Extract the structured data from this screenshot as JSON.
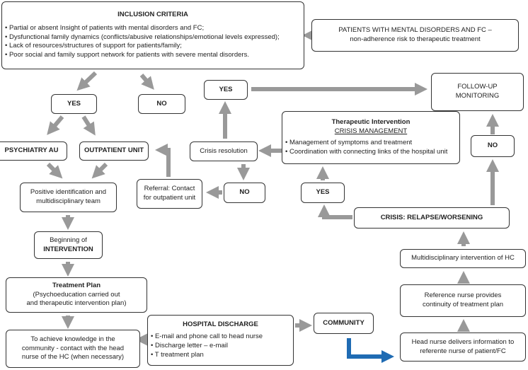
{
  "inclusion": {
    "title": "INCLUSION CRITERIA",
    "items": [
      "Partial or absent Insight of patients with mental disorders and FC;",
      "Dysfunctional family dynamics (conflicts/abusive relationships/emotional levels expressed);",
      "Lack of resources/structures of support for patients/family;",
      "Poor social and family support network for patients with severe mental disorders."
    ]
  },
  "patients": {
    "line1": "PATIENTS WITH MENTAL DISORDERS AND FC –",
    "line2": "non-adherence risk to therapeutic treatment"
  },
  "yes1": "YES",
  "no1": "NO",
  "yes2": "YES",
  "no2": "NO",
  "yes3": "YES",
  "no3": "NO",
  "psychiatry": "PSYCHIATRY AU",
  "outpatient": "OUTPATIENT UNIT",
  "positive": {
    "line1": "Positive identification and",
    "line2": "multidisciplinary team"
  },
  "beginning": {
    "line1": "Beginning of",
    "line2": "INTERVENTION"
  },
  "treatment": {
    "title": "Treatment Plan",
    "line1": "(Psychoeducation carried out",
    "line2": "and therapeutic intervention plan)"
  },
  "achieve": {
    "line1": "To achieve knowledge in the",
    "line2": "community - contact with the head",
    "line3": "nurse of the HC (when necessary)"
  },
  "discharge": {
    "title": "HOSPITAL DISCHARGE",
    "items": [
      "E-mail and phone call to head nurse",
      "Discharge letter – e-mail",
      "T treatment plan"
    ]
  },
  "community": "COMMUNITY",
  "headnurse": {
    "line1": "Head nurse delivers information to",
    "line2": "referente nurse of patient/FC"
  },
  "refnurse": {
    "line1": "Reference nurse provides",
    "line2": "continuity of treatment plan"
  },
  "multi_hc": "Multidisciplinary intervention of HC",
  "crisis": "CRISIS: RELAPSE/WORSENING",
  "referral": {
    "line1": "Referral: Contact",
    "line2": "for outpatient unit"
  },
  "resolution": "Crisis resolution",
  "therapeutic": {
    "title": "Therapeutic Intervention",
    "subtitle": "CRISIS MANAGEMENT",
    "items": [
      "Management of symptoms and treatment",
      "Coordination with connecting links of the hospital unit"
    ]
  },
  "followup": {
    "line1": "FOLLOW-UP",
    "line2": "MONITORING"
  },
  "colors": {
    "arrow": "#999999",
    "highlight_arrow": "#1f6bb3"
  }
}
